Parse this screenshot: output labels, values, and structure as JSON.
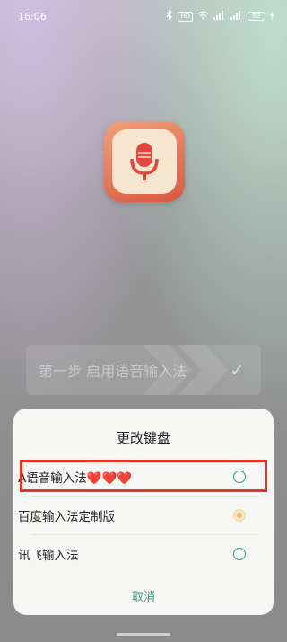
{
  "status_bar": {
    "time": "16:06",
    "icons": [
      "bluetooth-icon",
      "hd-icon",
      "wifi-icon",
      "signal-icon",
      "signal-icon",
      "battery-icon"
    ],
    "hd_label": "HD",
    "battery_level": "92"
  },
  "app_icon": {
    "name": "microphone-app-icon"
  },
  "step": {
    "label": "第一步 启用语音输入法",
    "check_icon": "check-icon"
  },
  "dialog": {
    "title": "更改键盘",
    "options": [
      {
        "label": "A语音输入法❤️❤️❤️",
        "selected": false
      },
      {
        "label": "百度输入法定制版",
        "selected": true
      },
      {
        "label": "讯飞输入法",
        "selected": false
      }
    ],
    "cancel_label": "取消"
  },
  "colors": {
    "accent": "#3f9a8c",
    "highlight": "#e53222",
    "app_icon_gradient_start": "#f2a07a",
    "app_icon_gradient_end": "#d9573f",
    "selected_radio": "#ebbd6a"
  }
}
